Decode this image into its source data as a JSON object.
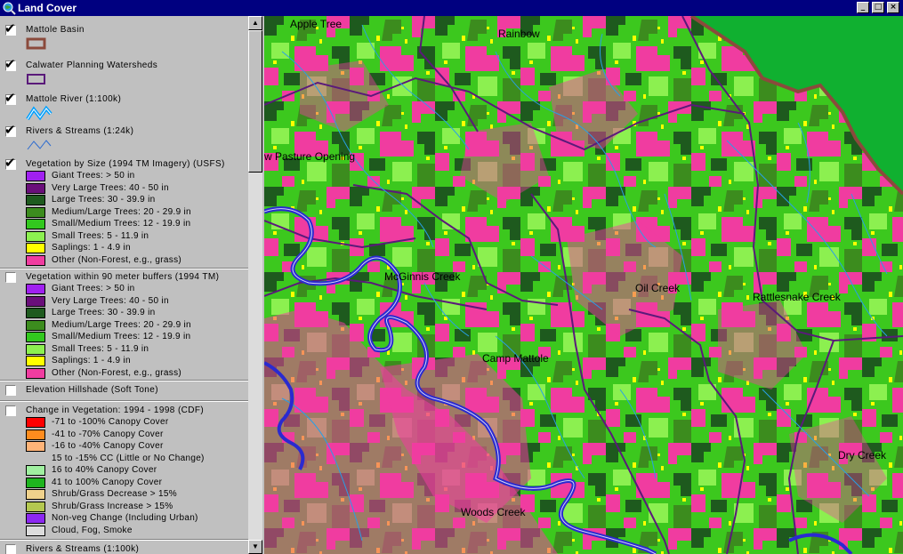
{
  "window": {
    "title": "Land Cover",
    "controls": {
      "minimize": "_",
      "maximize": "□",
      "close": "×"
    }
  },
  "legend": {
    "themes": [
      {
        "label": "Mattole Basin",
        "checked": true,
        "symbol": "mattole-basin-outline-icon"
      },
      {
        "label": "Calwater Planning Watersheds",
        "checked": true,
        "symbol": "watershed-outline-icon"
      },
      {
        "label": "Mattole River (1:100k)",
        "checked": true,
        "symbol": "river-line-icon"
      },
      {
        "label": "Rivers & Streams (1:24k)",
        "checked": true,
        "symbol": "stream-line-icon"
      },
      {
        "label": "Vegetation by Size (1994 TM Imagery) (USFS)",
        "checked": true,
        "classes": [
          {
            "label": "Giant Trees: > 50 in",
            "color": "#a020f0"
          },
          {
            "label": "Very Large Trees: 40 - 50 in",
            "color": "#6a0f7a"
          },
          {
            "label": "Large Trees: 30 - 39.9 in",
            "color": "#1e5a1e"
          },
          {
            "label": "Medium/Large Trees: 20 - 29.9 in",
            "color": "#3c8c1e"
          },
          {
            "label": "Small/Medium Trees: 12 - 19.9 in",
            "color": "#32c81e"
          },
          {
            "label": "Small Trees: 5 - 11.9 in",
            "color": "#8cf050"
          },
          {
            "label": "Saplings: 1 - 4.9 in",
            "color": "#ffff00"
          },
          {
            "label": "Other (Non-Forest, e.g., grass)",
            "color": "#f03ca0"
          }
        ]
      },
      {
        "label": "Vegetation within 90 meter buffers (1994 TM)",
        "checked": false,
        "classes": [
          {
            "label": "Giant Trees: > 50 in",
            "color": "#a020f0"
          },
          {
            "label": "Very Large Trees: 40 - 50 in",
            "color": "#6a0f7a"
          },
          {
            "label": "Large Trees: 30 - 39.9 in",
            "color": "#1e5a1e"
          },
          {
            "label": "Medium/Large Trees: 20 - 29.9 in",
            "color": "#3c8c1e"
          },
          {
            "label": "Small/Medium Trees: 12 - 19.9 in",
            "color": "#32c81e"
          },
          {
            "label": "Small Trees: 5 - 11.9 in",
            "color": "#8cf050"
          },
          {
            "label": "Saplings: 1 - 4.9 in",
            "color": "#ffff00"
          },
          {
            "label": "Other (Non-Forest, e.g., grass)",
            "color": "#f03ca0"
          }
        ]
      },
      {
        "label": "Elevation Hillshade (Soft Tone)",
        "checked": false
      },
      {
        "label": "Change in Vegetation: 1994 - 1998 (CDF)",
        "checked": false,
        "classes": [
          {
            "label": "-71 to -100% Canopy Cover",
            "color": "#ff0000"
          },
          {
            "label": "-41 to -70% Canopy Cover",
            "color": "#ff8c1e"
          },
          {
            "label": "-16 to -40% Canopy Cover",
            "color": "#ffb478"
          },
          {
            "label": "15 to -15% CC (Little or No Change)",
            "color": null
          },
          {
            "label": "16 to 40% Canopy Cover",
            "color": "#a0f0a0"
          },
          {
            "label": "41 to 100% Canopy Cover",
            "color": "#1eb41e"
          },
          {
            "label": "Shrub/Grass Decrease > 15%",
            "color": "#f0d28c"
          },
          {
            "label": "Shrub/Grass Increase > 15%",
            "color": "#b4c850"
          },
          {
            "label": "Non-veg Change (Including Urban)",
            "color": "#8c28f0"
          },
          {
            "label": "Cloud, Fog, Smoke",
            "color": "#dcdcdc"
          }
        ]
      },
      {
        "label": "Rivers & Streams (1:100k)",
        "checked": false
      }
    ]
  },
  "map": {
    "labels": [
      {
        "text": "Apple Tree"
      },
      {
        "text": "Rainbow"
      },
      {
        "text": "w Pasture Opening"
      },
      {
        "text": "McGinnis Creek"
      },
      {
        "text": "Oil Creek"
      },
      {
        "text": "Rattlesnake Creek"
      },
      {
        "text": "Camp Mattole"
      },
      {
        "text": "Dry Creek"
      },
      {
        "text": "Woods Creek"
      }
    ],
    "colors": {
      "outside_basin": "#10b030",
      "basin_boundary": "#8b4a3c",
      "watershed_boundary": "#5a1a7a",
      "river": "#2a2ad0",
      "stream": "#28a0e6"
    }
  }
}
